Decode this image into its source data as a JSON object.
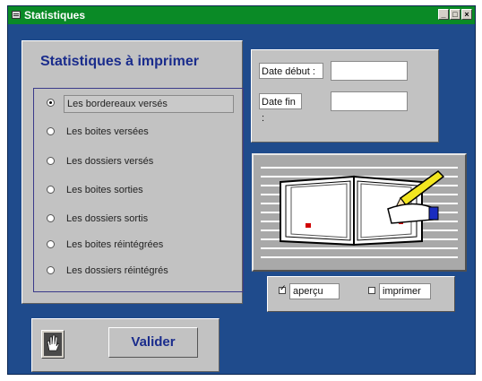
{
  "window": {
    "title": "Statistiques"
  },
  "titlebar_buttons": {
    "minimize": "_",
    "maximize": "□",
    "close": "×"
  },
  "main": {
    "heading": "Statistiques à imprimer",
    "options": [
      {
        "label": "Les bordereaux versés",
        "selected": true
      },
      {
        "label": "Les boites versées",
        "selected": false
      },
      {
        "label": "Les dossiers versés",
        "selected": false
      },
      {
        "label": "Les boites sorties",
        "selected": false
      },
      {
        "label": "Les dossiers sortis",
        "selected": false
      },
      {
        "label": "Les boites réintégrées",
        "selected": false
      },
      {
        "label": "Les dossiers réintégrés",
        "selected": false
      }
    ]
  },
  "dates": {
    "start_label": "Date début :",
    "end_label": "Date fin :",
    "start_value": "",
    "end_value": ""
  },
  "output": {
    "preview_label": "aperçu",
    "preview_checked": true,
    "print_label": "imprimer",
    "print_checked": false
  },
  "actions": {
    "validate_label": "Valider"
  },
  "colors": {
    "window_bg": "#1f4b8c",
    "titlebar": "#0a8a26",
    "panel": "#c2c2c2",
    "accent_text": "#1a2c8c"
  }
}
